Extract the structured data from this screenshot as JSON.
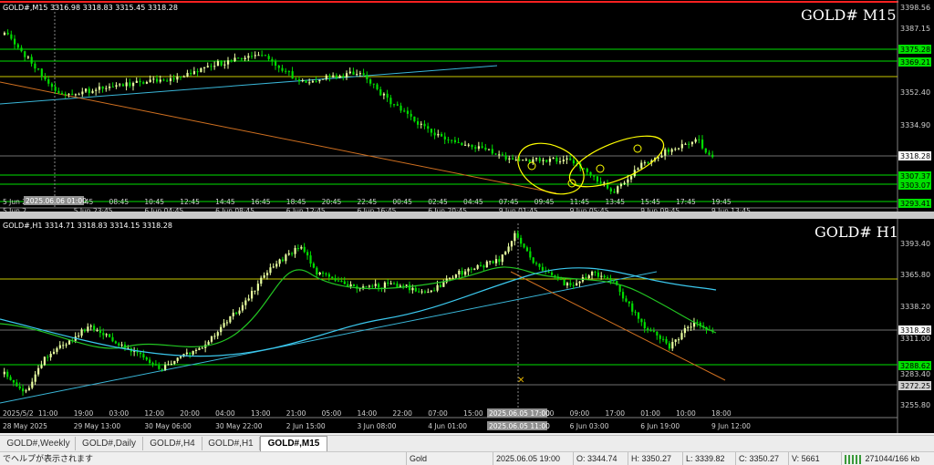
{
  "m15": {
    "symbol_title": "GOLD# M15",
    "info": "GOLD#,M15  3316.98 3318.83 3315.45 3318.28",
    "price_labels": [
      "3398.56",
      "3387.15",
      "3375.28",
      "3369.21",
      "3352.40",
      "3334.90",
      "3318.28",
      "3307.37",
      "3303.07",
      "3293.41"
    ],
    "time_labels_top": [
      "5 Jun 2025",
      "03:45",
      "05:45",
      "08:45",
      "10:45",
      "12:45",
      "14:45",
      "16:45",
      "18:45",
      "20:45",
      "22:45",
      "00:45",
      "02:45",
      "04:45",
      "07:45",
      "09:45",
      "11:45",
      "13:45",
      "15:45",
      "17:45",
      "19:45"
    ],
    "time_labels_bottom": [
      "5 Jun 2",
      "5 Jun 23:45",
      "6 Jun 04:45",
      "6 Jun 08:45",
      "6 Jun 12:45",
      "6 Jun 16:45",
      "6 Jun 20:45",
      "9 Jun 01:45",
      "9 Jun 05:45",
      "9 Jun 09:45",
      "9 Jun 13:45"
    ],
    "crosshair_top": "2025.06.06 01:00",
    "crosshair_bottom": "2025.06.05 19:00"
  },
  "h1": {
    "symbol_title": "GOLD# H1",
    "info": "GOLD#,H1  3314.71 3318.83 3314.15 3318.28",
    "price_labels": [
      "3393.40",
      "3365.80",
      "3338.20",
      "3318.28",
      "3311.00",
      "3288.62",
      "3283.40",
      "3272.25",
      "3255.80"
    ],
    "time_labels_top": [
      "2025/5/2",
      "11:00",
      "19:00",
      "03:00",
      "12:00",
      "20:00",
      "04:00",
      "13:00",
      "21:00",
      "05:00",
      "14:00",
      "22:00",
      "07:00",
      "15:00",
      "23:00",
      "00:00",
      "09:00",
      "17:00",
      "01:00",
      "10:00",
      "18:00"
    ],
    "time_labels_bottom": [
      "28 May 2025",
      "29 May 13:00",
      "30 May 06:00",
      "30 May 22:00",
      "2 Jun 15:00",
      "3 Jun 08:00",
      "4 Jun 01:00",
      "4 Jun 17:00",
      "6 Jun 03:00",
      "6 Jun 19:00",
      "9 Jun 12:00"
    ],
    "crosshair_top": "2025.06.05 17:00",
    "crosshair_bottom": "2025.06.05 11:00"
  },
  "tabs": [
    "GOLD#,Weekly",
    "GOLD#,Daily",
    "GOLD#,H4",
    "GOLD#,H1",
    "GOLD#,M15"
  ],
  "active_tab": "GOLD#,M15",
  "status": {
    "help": "でヘルプが表示されます",
    "symbol": "Gold",
    "datetime": "2025.06.05 19:00",
    "open": "O: 3344.74",
    "high": "H: 3350.27",
    "low": "L: 3339.82",
    "close": "C: 3350.27",
    "volume": "V: 5661",
    "traffic": "271044/166 kb"
  },
  "colors": {
    "background": "#000000",
    "bull_candle": "#e8ffa0",
    "bear_candle": "#00dc00",
    "support_line": "#00e000",
    "level_line": "#c8c800",
    "trend_up": "#39b6d8",
    "trend_down": "#d07020",
    "ma_fast": "#22c522",
    "ma_slow": "#3bc8ee",
    "annotation": "#ffff00"
  }
}
